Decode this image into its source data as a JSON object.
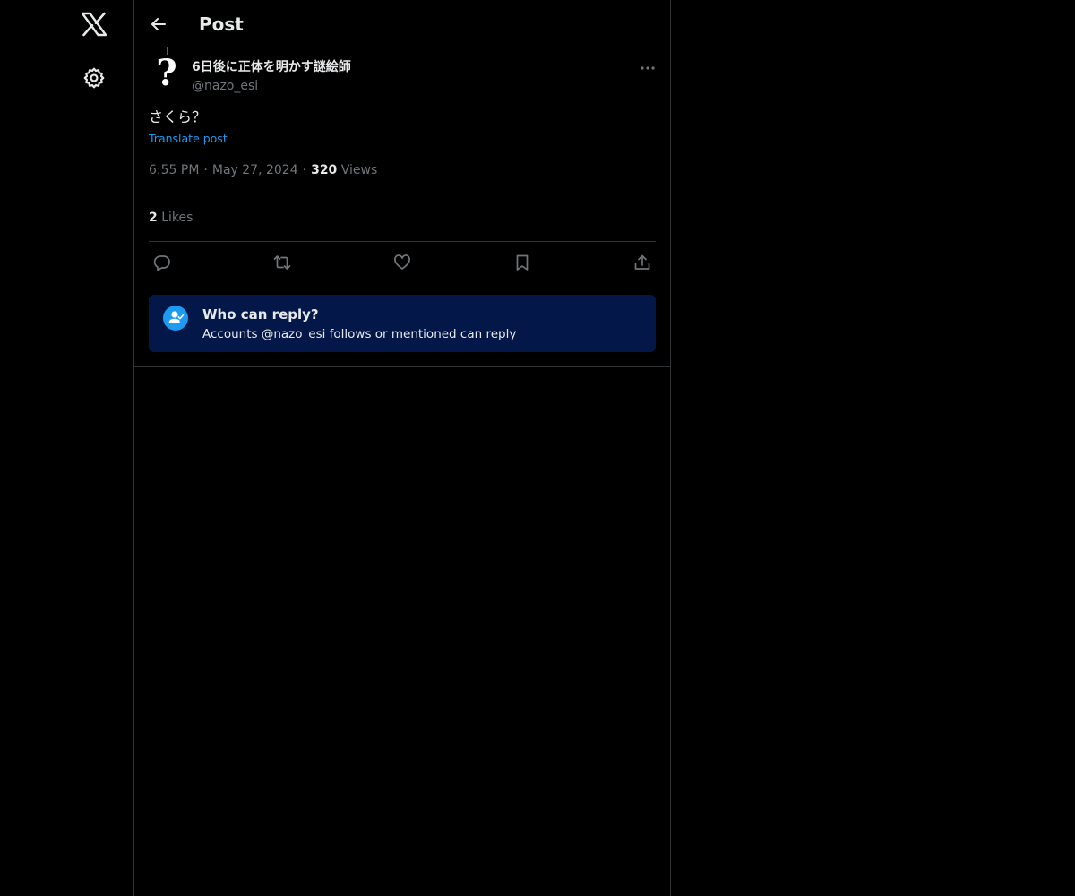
{
  "nav": {
    "logo_icon": "x-logo-icon",
    "settings_icon": "gear-icon"
  },
  "header": {
    "title": "Post",
    "back_icon": "arrow-left-icon"
  },
  "post": {
    "author_name": "6日後に正体を明かす謎絵師",
    "author_handle": "@nazo_esi",
    "avatar_glyph": "?",
    "text": "さくら？",
    "translate_label": "Translate post",
    "time": "6:55 PM",
    "date": "May 27, 2024",
    "views_count": "320",
    "views_label": "Views",
    "likes_count": "2",
    "likes_label": "Likes",
    "separator": "·"
  },
  "actions": {
    "reply_icon": "reply-bubble-icon",
    "repost_icon": "repost-icon",
    "like_icon": "heart-icon",
    "bookmark_icon": "bookmark-icon",
    "share_icon": "share-icon",
    "more_icon": "more-dots-icon"
  },
  "reply_restriction": {
    "title": "Who can reply?",
    "subtitle": "Accounts @nazo_esi follows or mentioned can reply",
    "icon": "user-check-icon"
  },
  "colors": {
    "background": "#000000",
    "text_primary": "#e7e9ea",
    "text_secondary": "#71767b",
    "accent": "#1d9bf0",
    "border": "#2f3336",
    "card_background": "#031849"
  }
}
